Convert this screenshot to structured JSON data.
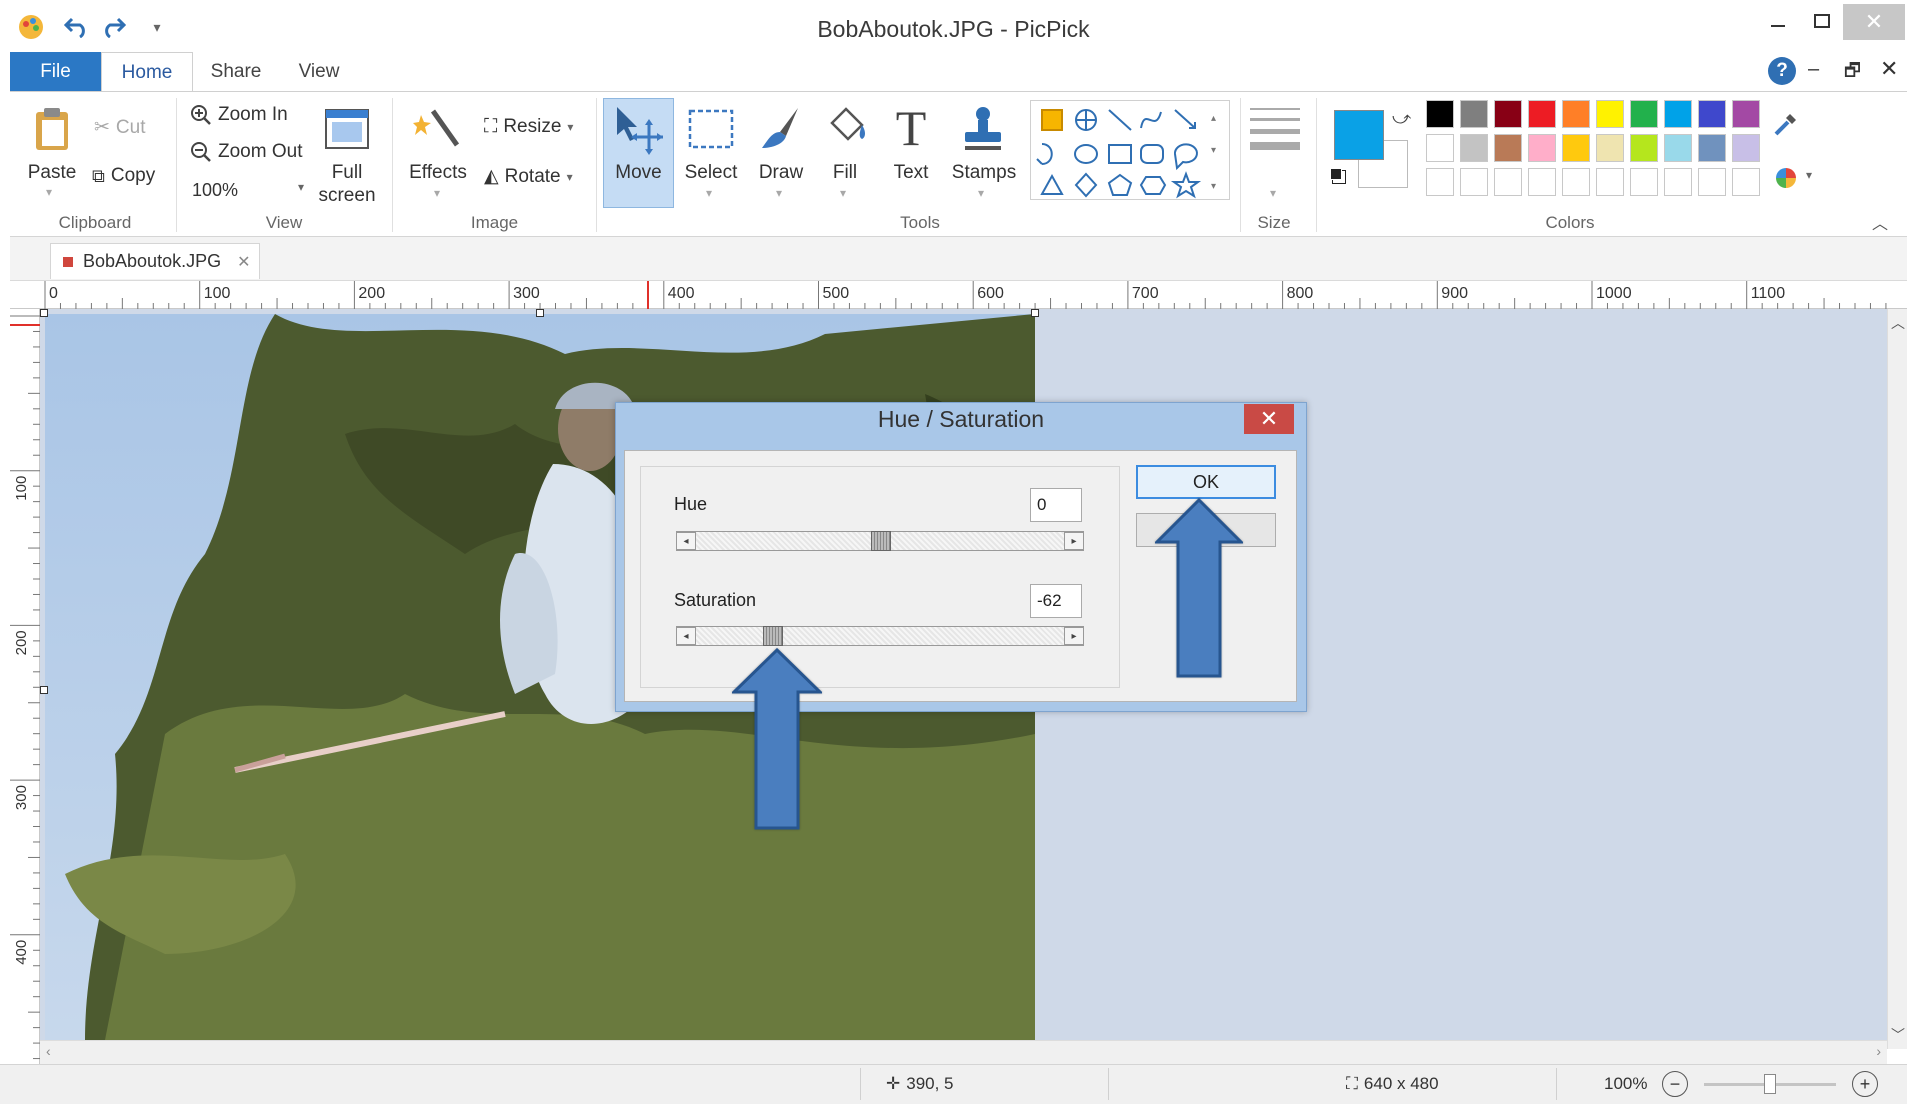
{
  "window": {
    "title": "BobAboutok.JPG - PicPick"
  },
  "ribbon_tabs": [
    "File",
    "Home",
    "Share",
    "View"
  ],
  "ribbon": {
    "clipboard": {
      "paste": "Paste",
      "cut": "Cut",
      "copy": "Copy",
      "label": "Clipboard"
    },
    "view": {
      "zoom_in": "Zoom In",
      "zoom_out": "Zoom Out",
      "zoom_level": "100%",
      "full_screen_1": "Full",
      "full_screen_2": "screen",
      "label": "View"
    },
    "image": {
      "effects": "Effects",
      "resize": "Resize",
      "rotate": "Rotate",
      "label": "Image"
    },
    "tools": {
      "move": "Move",
      "select": "Select",
      "draw": "Draw",
      "fill": "Fill",
      "text": "Text",
      "stamps": "Stamps",
      "label": "Tools"
    },
    "size": {
      "label": "Size"
    },
    "colors": {
      "label": "Colors",
      "primary": "#0aa1e6",
      "secondary": "#ffffff",
      "palette_row1": [
        "#000000",
        "#7f7f7f",
        "#880015",
        "#ed1c24",
        "#ff7f27",
        "#fff200",
        "#22b14c",
        "#00a2e8",
        "#3f48cc",
        "#a349a4"
      ],
      "palette_row2": [
        "#ffffff",
        "#c3c3c3",
        "#b97a57",
        "#ffaec9",
        "#ffc90e",
        "#efe4b0",
        "#b5e61d",
        "#99d9ea",
        "#7092be",
        "#c8bfe7"
      ],
      "palette_row3": [
        "#ffffff",
        "#ffffff",
        "#ffffff",
        "#ffffff",
        "#ffffff",
        "#ffffff",
        "#ffffff",
        "#ffffff",
        "#ffffff",
        "#ffffff"
      ]
    }
  },
  "document_tab": {
    "name": "BobAboutok.JPG"
  },
  "ruler": {
    "h_labels": [
      "0",
      "100",
      "200",
      "300",
      "400",
      "500",
      "600",
      "700",
      "800",
      "900",
      "1000",
      "1100"
    ],
    "v_labels": [
      "100",
      "200",
      "300",
      "400"
    ]
  },
  "dialog": {
    "title": "Hue / Saturation",
    "hue_label": "Hue",
    "hue_value": "0",
    "hue_position": 0.5,
    "saturation_label": "Saturation",
    "saturation_value": "-62",
    "saturation_position": 0.19,
    "ok": "OK"
  },
  "status": {
    "cursor": "390, 5",
    "image_size": "640 x 480",
    "zoom": "100%",
    "zoom_position": 0.5
  }
}
